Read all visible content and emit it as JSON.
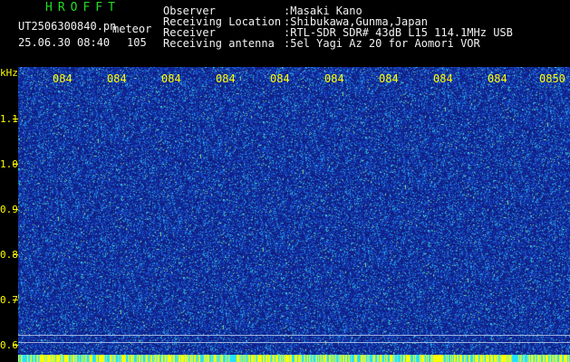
{
  "header": {
    "brand": "HROFFT",
    "filename": "UT2506300840.pn",
    "meteor_label": "meteor",
    "datetime": "25.06.30 08:40",
    "count": "105",
    "fields": [
      {
        "label": "Observer",
        "value": ":Masaki Kano"
      },
      {
        "label": "Receiving Location",
        "value": ":Shibukawa,Gunma,Japan"
      },
      {
        "label": "Receiver",
        "value": ":RTL-SDR SDR# 43dB L15 114.1MHz USB"
      },
      {
        "label": "Receiving antenna",
        "value": ":5el Yagi Az 20 for Aomori VOR"
      }
    ]
  },
  "axis": {
    "y_unit": "kHz",
    "y_labels": [
      "1.1",
      "1.0",
      "0.9",
      "0.8",
      "0.7",
      "0.6"
    ],
    "x_labels": [
      "084",
      "084",
      "084",
      "084",
      "084",
      "084",
      "084",
      "084",
      "084",
      "0850"
    ]
  },
  "colors": {
    "background": "#10208a",
    "text_primary": "#f2f2f2",
    "text_yellow": "#ffff00",
    "brand_green": "#22dd22"
  }
}
